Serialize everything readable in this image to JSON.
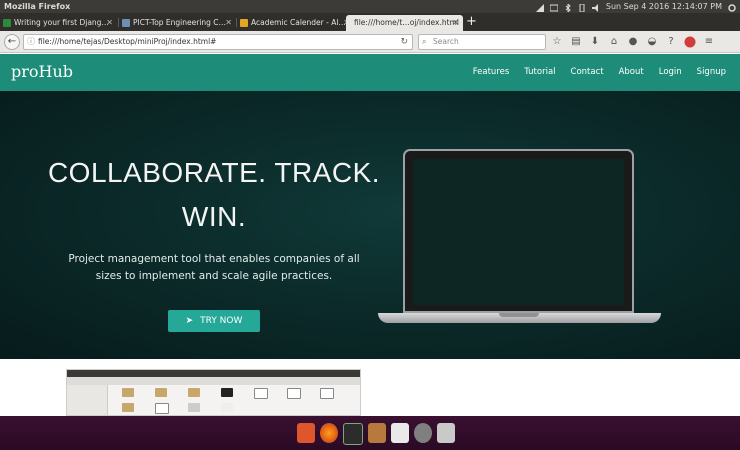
{
  "system_bar": {
    "app_title": "Mozilla Firefox",
    "clock": "Sun Sep  4 2016 12:14:07 PM",
    "tray_icons": [
      "network-icon",
      "keyboard-icon",
      "bluetooth-icon",
      "battery-icon",
      "volume-icon",
      "settings-gear-icon"
    ]
  },
  "browser": {
    "tabs": [
      {
        "label": "Writing your first Djang…",
        "favicon_color": "#2b8a3e",
        "active": false
      },
      {
        "label": "PICT-Top Engineering C…",
        "favicon_color": "#6c8fb3",
        "active": false
      },
      {
        "label": "Academic Calender - Al…",
        "favicon_color": "#e4a426",
        "active": false
      },
      {
        "label": "file:///home/t…oj/index.html",
        "favicon_color": "",
        "active": true
      }
    ],
    "new_tab_label": "+",
    "url": "file:///home/tejas/Desktop/miniProj/index.html#",
    "search_placeholder": "Search",
    "toolbar_icons": [
      "bookmark-star-icon",
      "reading-list-icon",
      "download-icon",
      "home-icon",
      "chat-icon",
      "pocket-icon",
      "question-icon",
      "adblock-icon",
      "menu-icon"
    ]
  },
  "site": {
    "logo": "proHub",
    "nav": [
      "Features",
      "Tutorial",
      "Contact",
      "About",
      "Login",
      "Signup"
    ],
    "hero": {
      "headline_line1": "COLLABORATE. TRACK.",
      "headline_line2": "WIN.",
      "subtext": "Project management tool that enables companies of all sizes to implement and scale agile practices.",
      "cta_label": "TRY NOW"
    }
  },
  "dock": {
    "icons": [
      "ubuntu-software-icon",
      "firefox-icon",
      "terminal-icon",
      "files-icon",
      "text-editor-icon",
      "system-settings-icon",
      "trash-icon"
    ]
  },
  "colors": {
    "site_header": "#1d8c78",
    "cta": "#26a899",
    "hero_bg": "#0b2b2a"
  }
}
